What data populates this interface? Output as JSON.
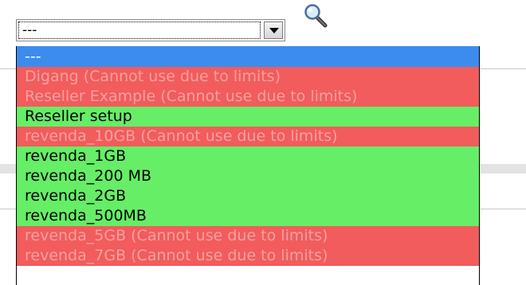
{
  "select": {
    "value": "---"
  },
  "search": {
    "icon": "magnifier-icon"
  },
  "options": [
    {
      "label": "---",
      "state": "selected"
    },
    {
      "label": "Digang (Cannot use due to limits)",
      "state": "disabled"
    },
    {
      "label": "Reseller Example (Cannot use due to limits)",
      "state": "disabled"
    },
    {
      "label": "Reseller setup",
      "state": "available"
    },
    {
      "label": "revenda_10GB (Cannot use due to limits)",
      "state": "disabled"
    },
    {
      "label": "revenda_1GB",
      "state": "available"
    },
    {
      "label": "revenda_200 MB",
      "state": "available"
    },
    {
      "label": "revenda_2GB",
      "state": "available"
    },
    {
      "label": "revenda_500MB",
      "state": "available"
    },
    {
      "label": "revenda_5GB (Cannot use due to limits)",
      "state": "disabled"
    },
    {
      "label": "revenda_7GB (Cannot use due to limits)",
      "state": "disabled"
    }
  ],
  "colors": {
    "selected": "#3c8cf0",
    "disabled": "#f25c5c",
    "disabled_text": "#f5a0a0",
    "available": "#66ee66"
  }
}
